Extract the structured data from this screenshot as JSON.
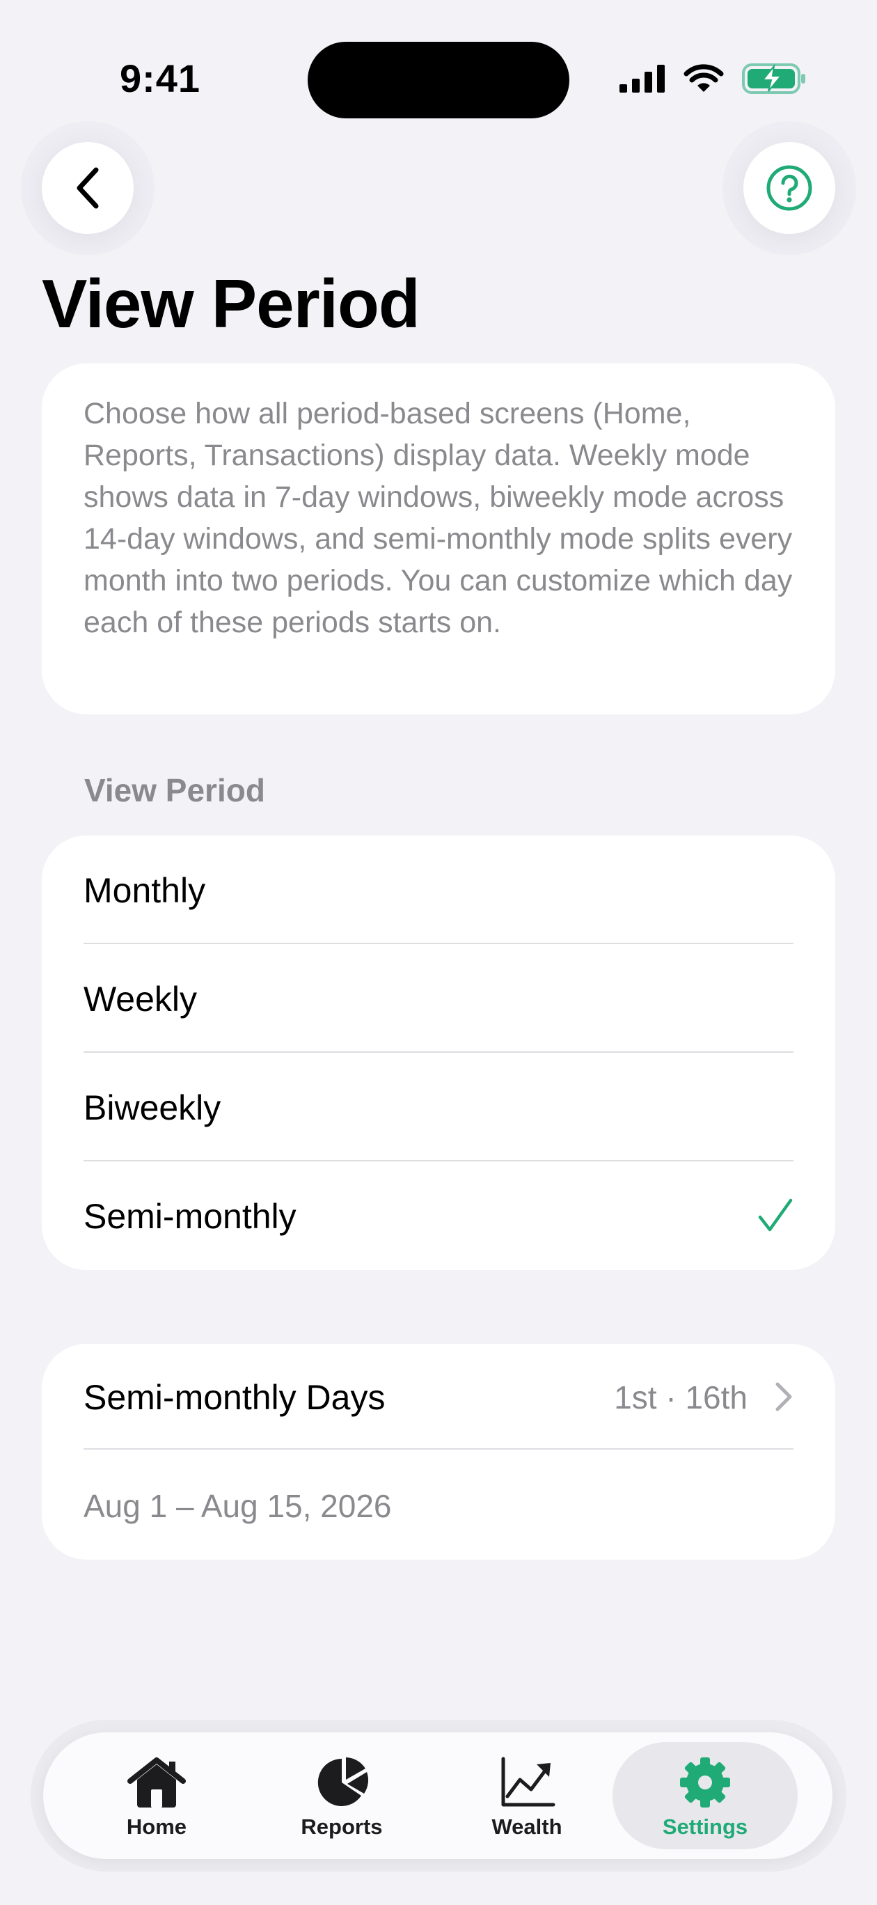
{
  "status_bar": {
    "time": "9:41",
    "icons": [
      "cellular-signal-icon",
      "wifi-icon",
      "battery-charging-icon"
    ]
  },
  "header": {
    "back_icon": "chevron-left-icon",
    "help_icon": "question-circle-icon",
    "title": "View Period"
  },
  "description": "Choose how all period-based screens (Home, Reports, Transactions) display data. Weekly mode shows data in 7-day windows, biweekly mode across 14-day windows, and semi-monthly mode splits every month into two periods. You can customize which day each of these periods starts on.",
  "view_period": {
    "section_label": "View Period",
    "options": [
      {
        "label": "Monthly",
        "selected": false
      },
      {
        "label": "Weekly",
        "selected": false
      },
      {
        "label": "Biweekly",
        "selected": false
      },
      {
        "label": "Semi-monthly",
        "selected": true
      }
    ]
  },
  "semi_monthly": {
    "label": "Semi-monthly Days",
    "value": "1st · 16th",
    "range": "Aug 1 – Aug 15, 2026"
  },
  "tab_bar": {
    "tabs": [
      {
        "label": "Home",
        "icon": "house-icon",
        "active": false
      },
      {
        "label": "Reports",
        "icon": "pie-chart-icon",
        "active": false
      },
      {
        "label": "Wealth",
        "icon": "line-chart-icon",
        "active": false
      },
      {
        "label": "Settings",
        "icon": "gear-icon",
        "active": true
      }
    ]
  },
  "colors": {
    "accent": "#1faa76",
    "background": "#f2f2f7",
    "secondary_text": "#8a8a8e"
  }
}
